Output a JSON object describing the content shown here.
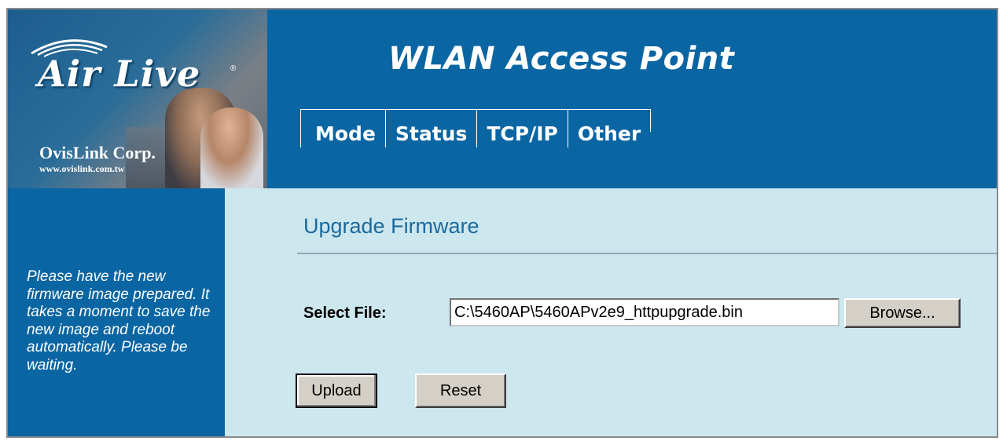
{
  "header": {
    "logo": {
      "brand": "Air Live",
      "registered_mark": "®",
      "company": "OvisLink Corp.",
      "url": "www.ovislink.com.tw"
    },
    "title": "WLAN Access Point",
    "nav": [
      {
        "label": "Mode"
      },
      {
        "label": "Status"
      },
      {
        "label": "TCP/IP"
      },
      {
        "label": "Other"
      }
    ]
  },
  "sidebar": {
    "help_text": "Please have the new firmware image prepared. It takes a moment to save the new image and reboot automatically. Please be waiting."
  },
  "main": {
    "page_title": "Upgrade Firmware",
    "select_file_label": "Select File:",
    "file_value": "C:\\5460AP\\5460APv2e9_httpupgrade.bin",
    "browse_label": "Browse...",
    "upload_label": "Upload",
    "reset_label": "Reset"
  },
  "colors": {
    "header_blue": "#0a65a3",
    "content_bg": "#cde7ee",
    "title_blue": "#1b6a9e",
    "button_face": "#d4d0c8"
  }
}
